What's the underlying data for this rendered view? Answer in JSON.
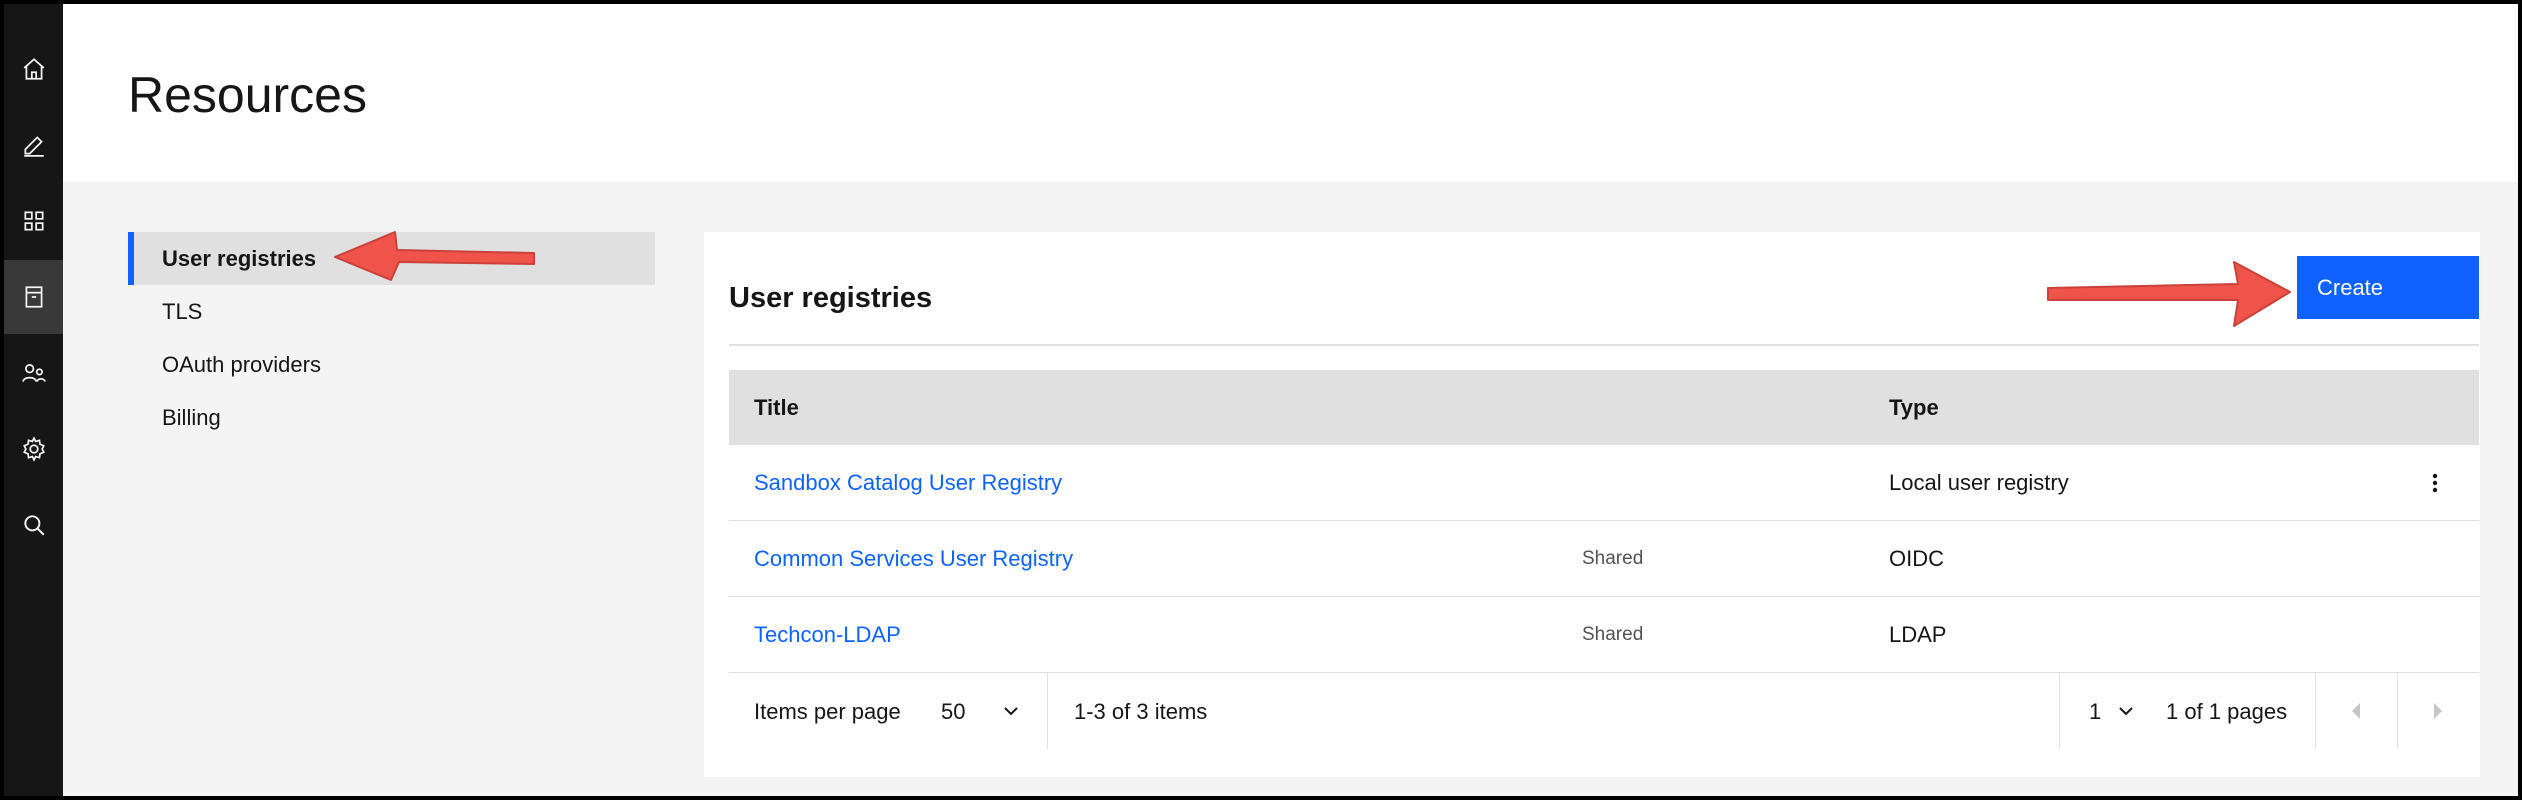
{
  "page": {
    "title": "Resources"
  },
  "rail": {
    "items": [
      {
        "icon": "home-icon"
      },
      {
        "icon": "edit-icon"
      },
      {
        "icon": "apps-grid-icon"
      },
      {
        "icon": "resources-icon",
        "active": true
      },
      {
        "icon": "users-icon"
      },
      {
        "icon": "settings-icon"
      },
      {
        "icon": "search-icon"
      }
    ]
  },
  "subnav": {
    "items": [
      {
        "label": "User registries",
        "active": true
      },
      {
        "label": "TLS"
      },
      {
        "label": "OAuth providers"
      },
      {
        "label": "Billing"
      }
    ]
  },
  "card": {
    "title": "User registries",
    "create_label": "Create",
    "columns": {
      "title": "Title",
      "type": "Type"
    },
    "rows": [
      {
        "title": "Sandbox Catalog User Registry",
        "shared": "",
        "type": "Local user registry"
      },
      {
        "title": "Common Services User Registry",
        "shared": "Shared",
        "type": "OIDC"
      },
      {
        "title": "Techcon-LDAP",
        "shared": "Shared",
        "type": "LDAP"
      }
    ],
    "pagination": {
      "items_per_page_label": "Items per page",
      "items_per_page": "50",
      "range": "1-3 of 3 items",
      "page": "1",
      "pages": "1 of 1 pages"
    }
  },
  "colors": {
    "accent": "#0f62fe",
    "link": "#0f62fe",
    "rail": "#161616",
    "arrow": "#f0534a"
  }
}
